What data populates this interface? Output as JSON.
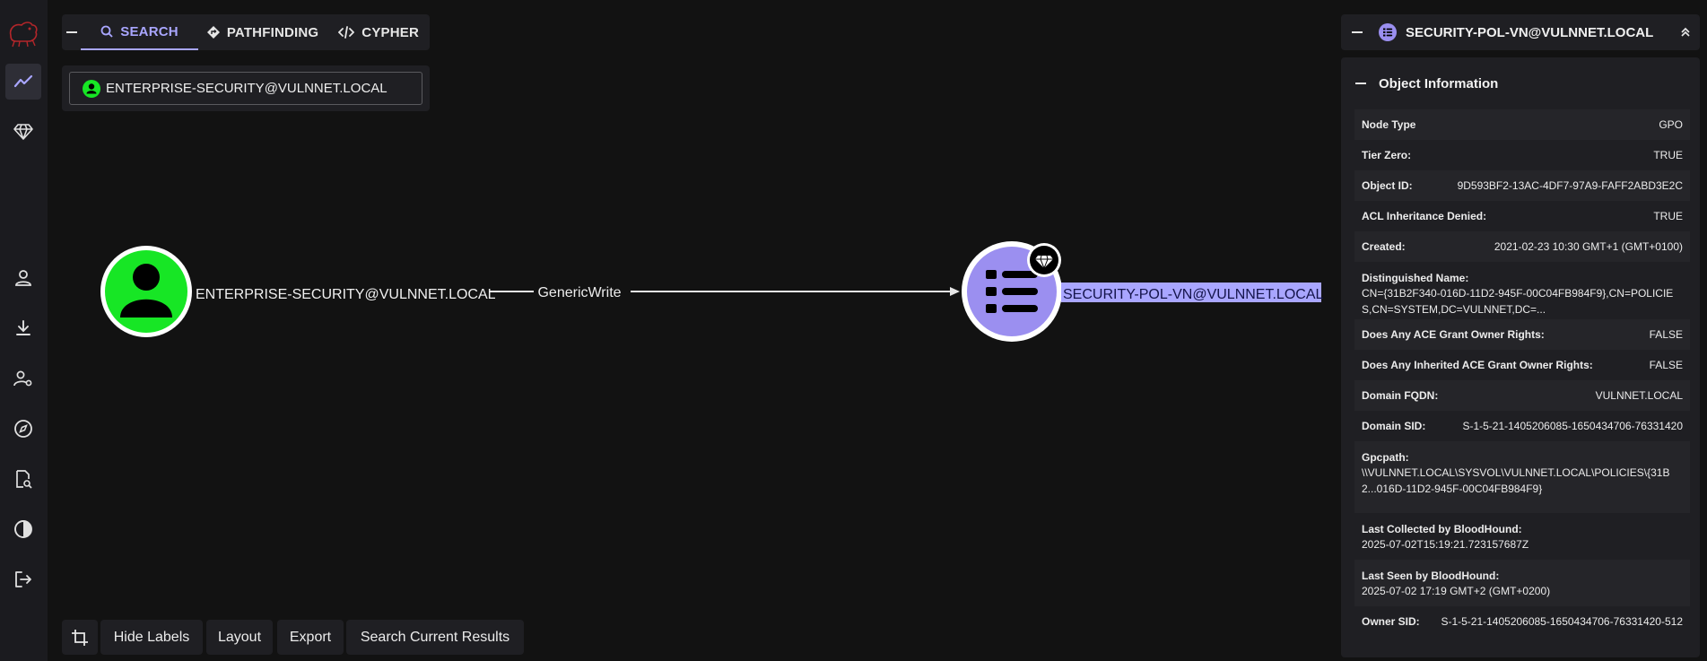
{
  "nav": {
    "tabs": [
      {
        "label": "SEARCH",
        "icon": "search-icon",
        "active": true
      },
      {
        "label": "PATHFINDING",
        "icon": "pathfinding-icon",
        "active": false
      },
      {
        "label": "CYPHER",
        "icon": "code-icon",
        "active": false
      }
    ],
    "search_value": "ENTERPRISE-SECURITY@VULNNET.LOCAL"
  },
  "graph": {
    "source_label": "ENTERPRISE-SECURITY@VULNNET.LOCAL",
    "edge_label": "GenericWrite",
    "target_label": "SECURITY-POL-VN@VULNNET.LOCAL",
    "source_color": "#17e625",
    "target_color": "#9b8ff0"
  },
  "toolbar": {
    "hide_labels": "Hide Labels",
    "layout": "Layout",
    "export": "Export",
    "search_current": "Search Current Results"
  },
  "panel": {
    "title": "SECURITY-POL-VN@VULNNET.LOCAL",
    "section": "Object Information",
    "rows": [
      {
        "k": "Node Type",
        "v": "GPO"
      },
      {
        "k": "Tier Zero:",
        "v": "TRUE"
      },
      {
        "k": "Object ID:",
        "v": "9D593BF2-13AC-4DF7-97A9-FAFF2ABD3E2C"
      },
      {
        "k": "ACL Inheritance Denied:",
        "v": "TRUE"
      },
      {
        "k": "Created:",
        "v": "2021-02-23 10:30 GMT+1 (GMT+0100)"
      },
      {
        "k": "Distinguished Name:",
        "v": "CN={31B2F340-016D-11D2-945F-00C04FB984F9},CN=POLICIES,CN=SYSTEM,DC=VULNNET,DC=..."
      },
      {
        "k": "Does Any ACE Grant Owner Rights:",
        "v": "FALSE"
      },
      {
        "k": "Does Any Inherited ACE Grant Owner Rights:",
        "v": "FALSE"
      },
      {
        "k": "Domain FQDN:",
        "v": "VULNNET.LOCAL"
      },
      {
        "k": "Domain SID:",
        "v": "S-1-5-21-1405206085-1650434706-76331420"
      },
      {
        "k": "Gpcpath:",
        "v": "\\\\VULNNET.LOCAL\\SYSVOL\\VULNNET.LOCAL\\POLICIES\\{31B2...016D-11D2-945F-00C04FB984F9}"
      },
      {
        "k": "Last Collected by BloodHound:",
        "v": "2025-07-02T15:19:21.723157687Z"
      },
      {
        "k": "Last Seen by BloodHound:",
        "v": "2025-07-02 17:19 GMT+2 (GMT+0200)"
      },
      {
        "k": "Owner SID:",
        "v": "S-1-5-21-1405206085-1650434706-76331420-512"
      }
    ]
  }
}
